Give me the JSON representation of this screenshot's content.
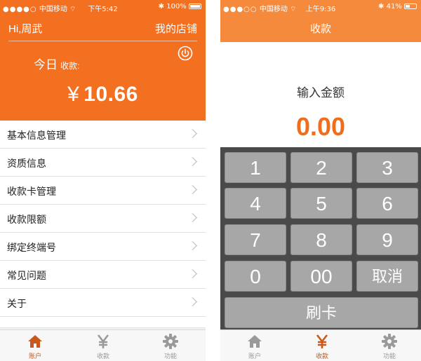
{
  "left": {
    "status": {
      "carrier": "中国移动",
      "time": "下午5:42",
      "battery": "100%",
      "battery_level": 1.0
    },
    "greeting": "Hi,周武",
    "store_link": "我的店铺",
    "today_label": "今日",
    "receipt_label": "收款:",
    "amount_symbol": "¥",
    "amount": "10.66",
    "menu": [
      {
        "label": "基本信息管理"
      },
      {
        "label": "资质信息"
      },
      {
        "label": "收款卡管理"
      },
      {
        "label": "收款限额"
      },
      {
        "label": "绑定终端号"
      },
      {
        "label": "常见问题"
      },
      {
        "label": "关于"
      }
    ],
    "tabs": [
      {
        "label": "账户",
        "icon": "home-icon",
        "active": true
      },
      {
        "label": "收款",
        "icon": "yen-icon",
        "active": false
      },
      {
        "label": "功能",
        "icon": "gear-icon",
        "active": false
      }
    ]
  },
  "right": {
    "status": {
      "carrier": "中国移动",
      "time": "上午9:36",
      "battery": "41%",
      "battery_level": 0.41
    },
    "title": "收款",
    "input_label": "输入金额",
    "input_value": "0.00",
    "keys": [
      "1",
      "2",
      "3",
      "4",
      "5",
      "6",
      "7",
      "8",
      "9",
      "0",
      "00",
      "取消"
    ],
    "swipe_button": "刷卡",
    "tabs": [
      {
        "label": "账户",
        "icon": "home-icon",
        "active": false
      },
      {
        "label": "收款",
        "icon": "yen-icon",
        "active": true
      },
      {
        "label": "功能",
        "icon": "gear-icon",
        "active": false
      }
    ]
  },
  "colors": {
    "brand_orange": "#f37021",
    "header_orange_light": "#f68a3c",
    "amount_orange": "#f06d1d",
    "keypad_bg": "#4a4a4a",
    "key_bg": "#a7a7a7",
    "tab_active": "#c9581a",
    "tab_inactive": "#999999"
  }
}
